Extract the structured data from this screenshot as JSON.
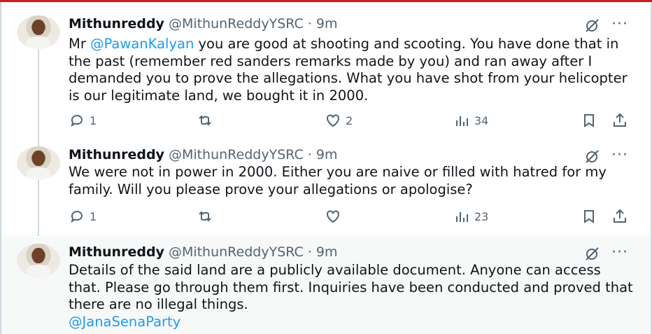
{
  "tweets": [
    {
      "name": "Mithunreddy",
      "handle": "@MithunReddyYSRC · 9m",
      "mention": "@PawanKalyan",
      "text": " you are good at shooting and scooting. You have done that in the past (remember red sanders remarks made by you) and ran away after I demanded you to prove the allegations. What you have shot from your helicopter is our legitimate land, we bought it in 2000.",
      "text_prefix": "Mr ",
      "replies": "1",
      "retweets": "",
      "likes": "2",
      "views": "34"
    },
    {
      "name": "Mithunreddy",
      "handle": "@MithunReddyYSRC · 9m",
      "text": "We were not in power in 2000. Either you are naive or filled with hatred for my family. Will you please prove your allegations or apologise?",
      "replies": "1",
      "retweets": "",
      "likes": "",
      "views": "23"
    },
    {
      "name": "Mithunreddy",
      "handle": "@MithunReddyYSRC · 9m",
      "text": "Details of the said land are a publicly available document. Anyone can access that. Please go through them first. Inquiries have been conducted and proved that there are no illegal things.",
      "mention": "@JanaSenaParty"
    }
  ],
  "more_label": "···",
  "colors": {
    "link": "#1d9bf0",
    "muted": "#536471",
    "text": "#0f1419",
    "top_bar": "#c81e1e"
  },
  "icons": [
    "grok-icon",
    "more-icon",
    "reply-icon",
    "retweet-icon",
    "like-icon",
    "views-icon",
    "bookmark-icon",
    "share-icon"
  ]
}
